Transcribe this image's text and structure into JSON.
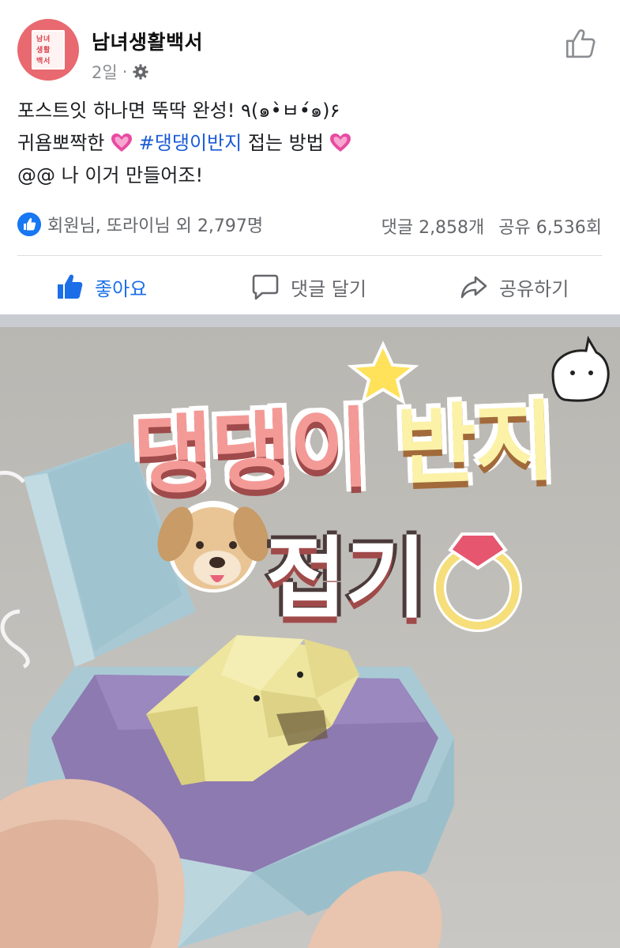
{
  "header": {
    "page_name": "남녀생활백서",
    "time": "2일",
    "dot": "·",
    "avatar_lines": [
      "남",
      "녀",
      "생",
      "활",
      "백",
      "서"
    ]
  },
  "post": {
    "line1": "포스트잇 하나면 뚝딱 완성! ٩(๑•̀ㅂ•́๑)۶",
    "line2_prefix": "귀욤뽀짝한",
    "line2_hashtag": "#댕댕이반지",
    "line2_suffix": "접는 방법",
    "line3": "@@ 나 이거 만들어조!"
  },
  "stats": {
    "reactions": "회원님, 또라이님 외 2,797명",
    "comments": "댓글 2,858개",
    "shares": "공유 6,536회"
  },
  "actions": {
    "like": "좋아요",
    "comment": "댓글 달기",
    "share": "공유하기"
  },
  "media": {
    "title_pink": "댕댕이",
    "title_yellow": "반지",
    "title_line2": "접기"
  },
  "colors": {
    "accent": "#1877f2",
    "like_active": "#1b6ee8",
    "hashtag": "#1b5bd6",
    "heart": "#e84ba0",
    "avatar_bg": "#e8696f"
  },
  "icons": {
    "like_top": "thumbs-up-outline-icon",
    "gear": "gear-icon",
    "like_badge": "like-badge-icon",
    "like": "thumbs-up-filled-icon",
    "comment": "comment-bubble-icon",
    "share": "share-arrow-icon"
  }
}
